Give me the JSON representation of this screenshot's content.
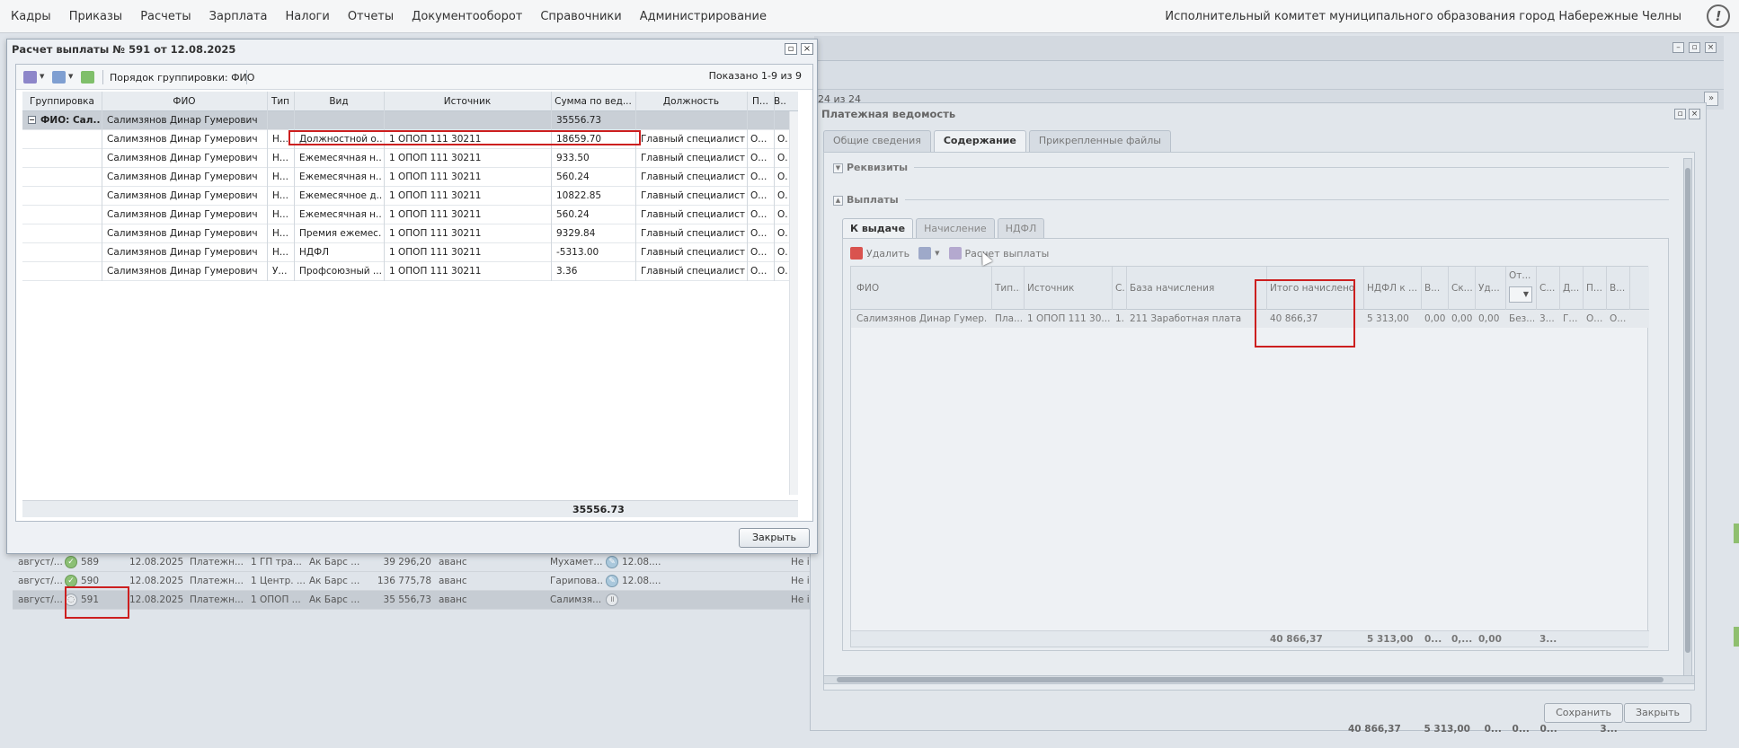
{
  "menu": [
    "Кадры",
    "Приказы",
    "Расчеты",
    "Зарплата",
    "Налоги",
    "Отчеты",
    "Документооборот",
    "Справочники",
    "Администрирование"
  ],
  "org": "Исполнительный комитет муниципального образования город Набережные Челны",
  "info_glyph": "!",
  "bg_pager": "24 из 24",
  "bg_rows": [
    {
      "period": "август/...",
      "num": "589",
      "date": "12.08.2025",
      "type": "Платежн...",
      "source": "1 ГП тра...",
      "bank": "Ак Барс ...",
      "amount": "39 296,20",
      "kind": "аванс",
      "person": "Мухамет...",
      "sign_date": "12.08....",
      "status": "Не і"
    },
    {
      "period": "август/...",
      "num": "590",
      "date": "12.08.2025",
      "type": "Платежн...",
      "source": "1 Центр. ...",
      "bank": "Ак Барс ...",
      "amount": "136 775,78",
      "kind": "аванс",
      "person": "Гарипова...",
      "sign_date": "12.08....",
      "status": "Не і"
    },
    {
      "period": "август/...",
      "num": "591",
      "date": "12.08.2025",
      "type": "Платежн...",
      "source": "1 ОПОП ...",
      "bank": "Ак Барс ...",
      "amount": "35 556,73",
      "kind": "аванс",
      "person": "Салимзя...",
      "sign_date": "",
      "status": "Не і"
    }
  ],
  "rwin": {
    "title": "Платежная ведомость",
    "tabs": [
      "Общие сведения",
      "Содержание",
      "Прикрепленные файлы"
    ],
    "sect_requisites": "Реквизиты",
    "sect_payments": "Выплаты",
    "subtabs": [
      "К выдаче",
      "Начисление",
      "НДФЛ"
    ],
    "tool_delete": "Удалить",
    "tool_calc": "Расчет выплаты",
    "headers": [
      "ФИО",
      "Тип...",
      "Источник",
      "С.",
      "База начисления",
      "Итого начислено",
      "НДФЛ к ...",
      "В...",
      "Ск...",
      "Уд...",
      "От...",
      "С...",
      "Д...",
      "П...",
      "В..."
    ],
    "row": [
      "Салимзянов Динар Гумер...",
      "Пла...",
      "1 ОПОП 111 30...",
      "1.",
      "211 Заработная плата",
      "40 866,37",
      "5 313,00",
      "0,00",
      "0,00",
      "0,00",
      "Без...",
      "3...",
      "Г...",
      "О...",
      "О..."
    ],
    "sum": [
      "40 866,37",
      "5 313,00",
      "0...",
      "0,...",
      "0,00",
      "3..."
    ],
    "bottom_sum": [
      "40 866,37",
      "5 313,00",
      "0...",
      "0...",
      "0...",
      "3..."
    ],
    "btn_save": "Сохранить",
    "btn_close": "Закрыть"
  },
  "modal": {
    "title": "Расчет выплаты № 591 от 12.08.2025",
    "grouping_label": "Порядок группировки:",
    "grouping_value": "ФИО",
    "shown": "Показано 1-9 из 9",
    "headers": [
      "Группировка",
      "ФИО",
      "Тип",
      "Вид",
      "Источник",
      "Сумма по вед...",
      "Должность",
      "П...",
      "В..."
    ],
    "group_row": {
      "label": "ФИО: Сал...",
      "fio": "Салимзянов Динар Гумерович",
      "sum": "35556.73"
    },
    "rows": [
      {
        "fio": "Салимзянов Динар Гумерович",
        "type": "Н...",
        "kind": "Должностной о...",
        "source": "1 ОПОП 111 30211",
        "sum": "18659.70",
        "pos": "Главный специалист",
        "p": "О...",
        "v": "О."
      },
      {
        "fio": "Салимзянов Динар Гумерович",
        "type": "Н...",
        "kind": "Ежемесячная н...",
        "source": "1 ОПОП 111 30211",
        "sum": "933.50",
        "pos": "Главный специалист",
        "p": "О...",
        "v": "О."
      },
      {
        "fio": "Салимзянов Динар Гумерович",
        "type": "Н...",
        "kind": "Ежемесячная н...",
        "source": "1 ОПОП 111 30211",
        "sum": "560.24",
        "pos": "Главный специалист",
        "p": "О...",
        "v": "О."
      },
      {
        "fio": "Салимзянов Динар Гумерович",
        "type": "Н...",
        "kind": "Ежемесячное д...",
        "source": "1 ОПОП 111 30211",
        "sum": "10822.85",
        "pos": "Главный специалист",
        "p": "О...",
        "v": "О."
      },
      {
        "fio": "Салимзянов Динар Гумерович",
        "type": "Н...",
        "kind": "Ежемесячная н...",
        "source": "1 ОПОП 111 30211",
        "sum": "560.24",
        "pos": "Главный специалист",
        "p": "О...",
        "v": "О."
      },
      {
        "fio": "Салимзянов Динар Гумерович",
        "type": "Н...",
        "kind": "Премия ежемес...",
        "source": "1 ОПОП 111 30211",
        "sum": "9329.84",
        "pos": "Главный специалист",
        "p": "О...",
        "v": "О."
      },
      {
        "fio": "Салимзянов Динар Гумерович",
        "type": "Н...",
        "kind": "НДФЛ",
        "source": "1 ОПОП 111 30211",
        "sum": "-5313.00",
        "pos": "Главный специалист",
        "p": "О...",
        "v": "О."
      },
      {
        "fio": "Салимзянов Динар Гумерович",
        "type": "У...",
        "kind": "Профсоюзный ...",
        "source": "1 ОПОП 111 30211",
        "sum": "3.36",
        "pos": "Главный специалист",
        "p": "О...",
        "v": "О."
      }
    ],
    "footer_total": "35556.73",
    "close_label": "Закрыть"
  },
  "colors": {
    "highlight": "#cc1f1f",
    "ok": "#8cc075",
    "accent_red": "#d9534f"
  }
}
